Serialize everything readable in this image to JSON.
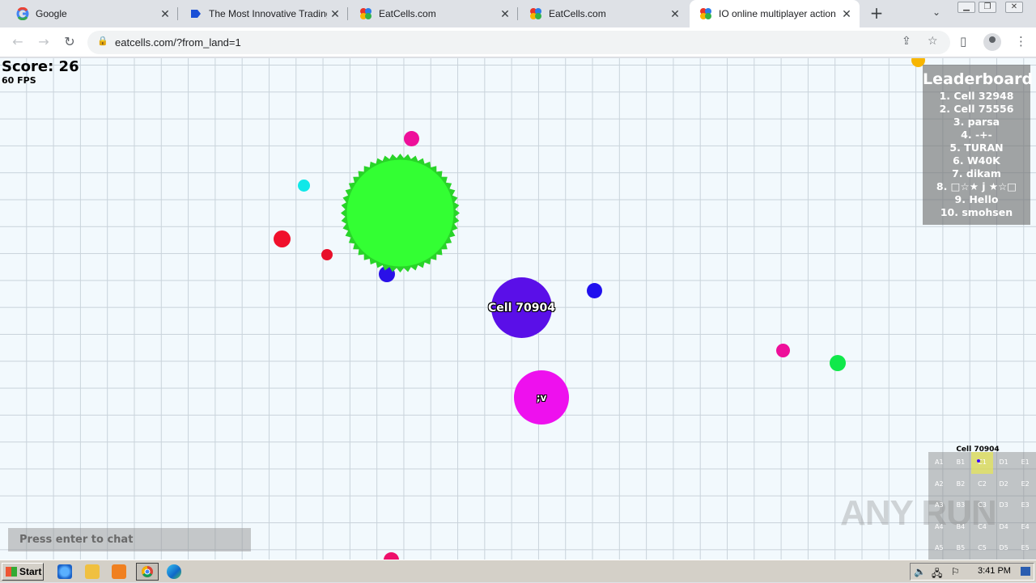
{
  "browser": {
    "tabs": [
      {
        "title": "Google",
        "favicon": "google-icon",
        "active": false
      },
      {
        "title": "The Most Innovative Trading Pl",
        "favicon": "trading-site-icon",
        "active": false
      },
      {
        "title": "EatCells.com",
        "favicon": "eatcells-icon",
        "active": false
      },
      {
        "title": "EatCells.com",
        "favicon": "eatcells-icon",
        "active": false
      },
      {
        "title": "IO online multiplayer action ga",
        "favicon": "eatcells-icon",
        "active": true
      }
    ],
    "new_tab_label": "+",
    "url": "eatcells.com/?from_land=1"
  },
  "game": {
    "score_text": "Score: 26",
    "fps_text": "60 FPS",
    "leaderboard": {
      "title": "Leaderboard",
      "entries": [
        "1. Cell 32948",
        "2. Cell 75556",
        "3. parsa",
        "4. -+-",
        "5. TURAN",
        "6. W40K",
        "7. dikam",
        "8. □☆★ j ★☆□",
        "9. Hello",
        "10. smohsen"
      ]
    },
    "cells": [
      {
        "name": "Cell 70904",
        "color": "#5a0fe8"
      },
      {
        "name": ";v",
        "color": "#ee10ee"
      }
    ],
    "virus_color": "#33ff33",
    "minimap": {
      "label": "Cell 70904",
      "rows": [
        [
          "A1",
          "B1",
          "C1",
          "D1",
          "E1"
        ],
        [
          "A2",
          "B2",
          "C2",
          "D2",
          "E2"
        ],
        [
          "A3",
          "B3",
          "C3",
          "D3",
          "E3"
        ],
        [
          "A4",
          "B4",
          "C4",
          "D4",
          "E4"
        ],
        [
          "A5",
          "B5",
          "C5",
          "D5",
          "E5"
        ]
      ],
      "current_sector": "C1"
    },
    "chat_placeholder": "Press enter to chat"
  },
  "watermark": "ANY RUN",
  "taskbar": {
    "start_label": "Start",
    "clock": "3:41 PM"
  }
}
